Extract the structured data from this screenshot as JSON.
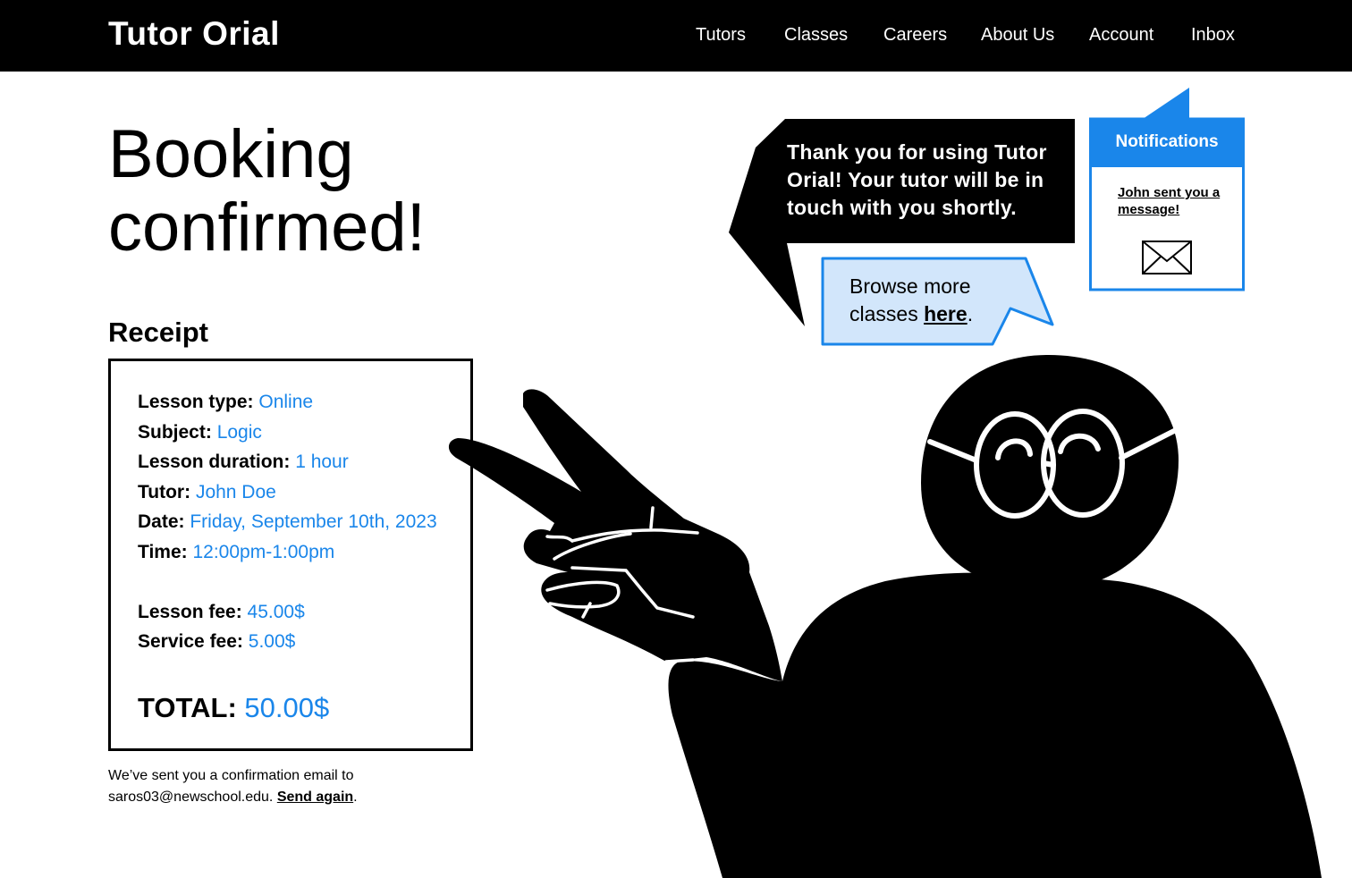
{
  "header": {
    "logo_part1": "Tutor ",
    "logo_o": "O",
    "logo_part2": "rial",
    "nav": [
      "Tutors",
      "Classes",
      "Careers",
      "About Us",
      "Account",
      "Inbox"
    ]
  },
  "main": {
    "headline_line1": "Booking",
    "headline_line2": "confirmed!",
    "receipt_title": "Receipt",
    "receipt": {
      "lesson_type_label": "Lesson type:",
      "lesson_type_value": "Online",
      "subject_label": "Subject:",
      "subject_value": "Logic",
      "duration_label": "Lesson duration:",
      "duration_value": "1 hour",
      "tutor_label": "Tutor:",
      "tutor_value": "John Doe",
      "date_label": "Date:",
      "date_value": "Friday, September 10th, 2023",
      "time_label": "Time:",
      "time_value": "12:00pm-1:00pm",
      "lesson_fee_label": "Lesson fee:",
      "lesson_fee_value": "45.00$",
      "service_fee_label": "Service fee:",
      "service_fee_value": "5.00$",
      "total_label": "TOTAL:",
      "total_value": "50.00$"
    },
    "confirmation_text": "We’ve sent you a confirmation email to saros03@newschool.edu.",
    "send_again": "Send again"
  },
  "speech": {
    "thanks": "Thank you for using Tutor Orial! Your tutor will be in touch with you shortly.",
    "browse_prefix": "Browse more classes ",
    "browse_link": "here",
    "browse_suffix": "."
  },
  "notifications": {
    "title": "Notifications",
    "message": "John sent you a message!",
    "icon": "envelope-icon"
  },
  "colors": {
    "accent": "#1a86ea",
    "light_blue": "#d2e6fb",
    "black": "#000000"
  }
}
